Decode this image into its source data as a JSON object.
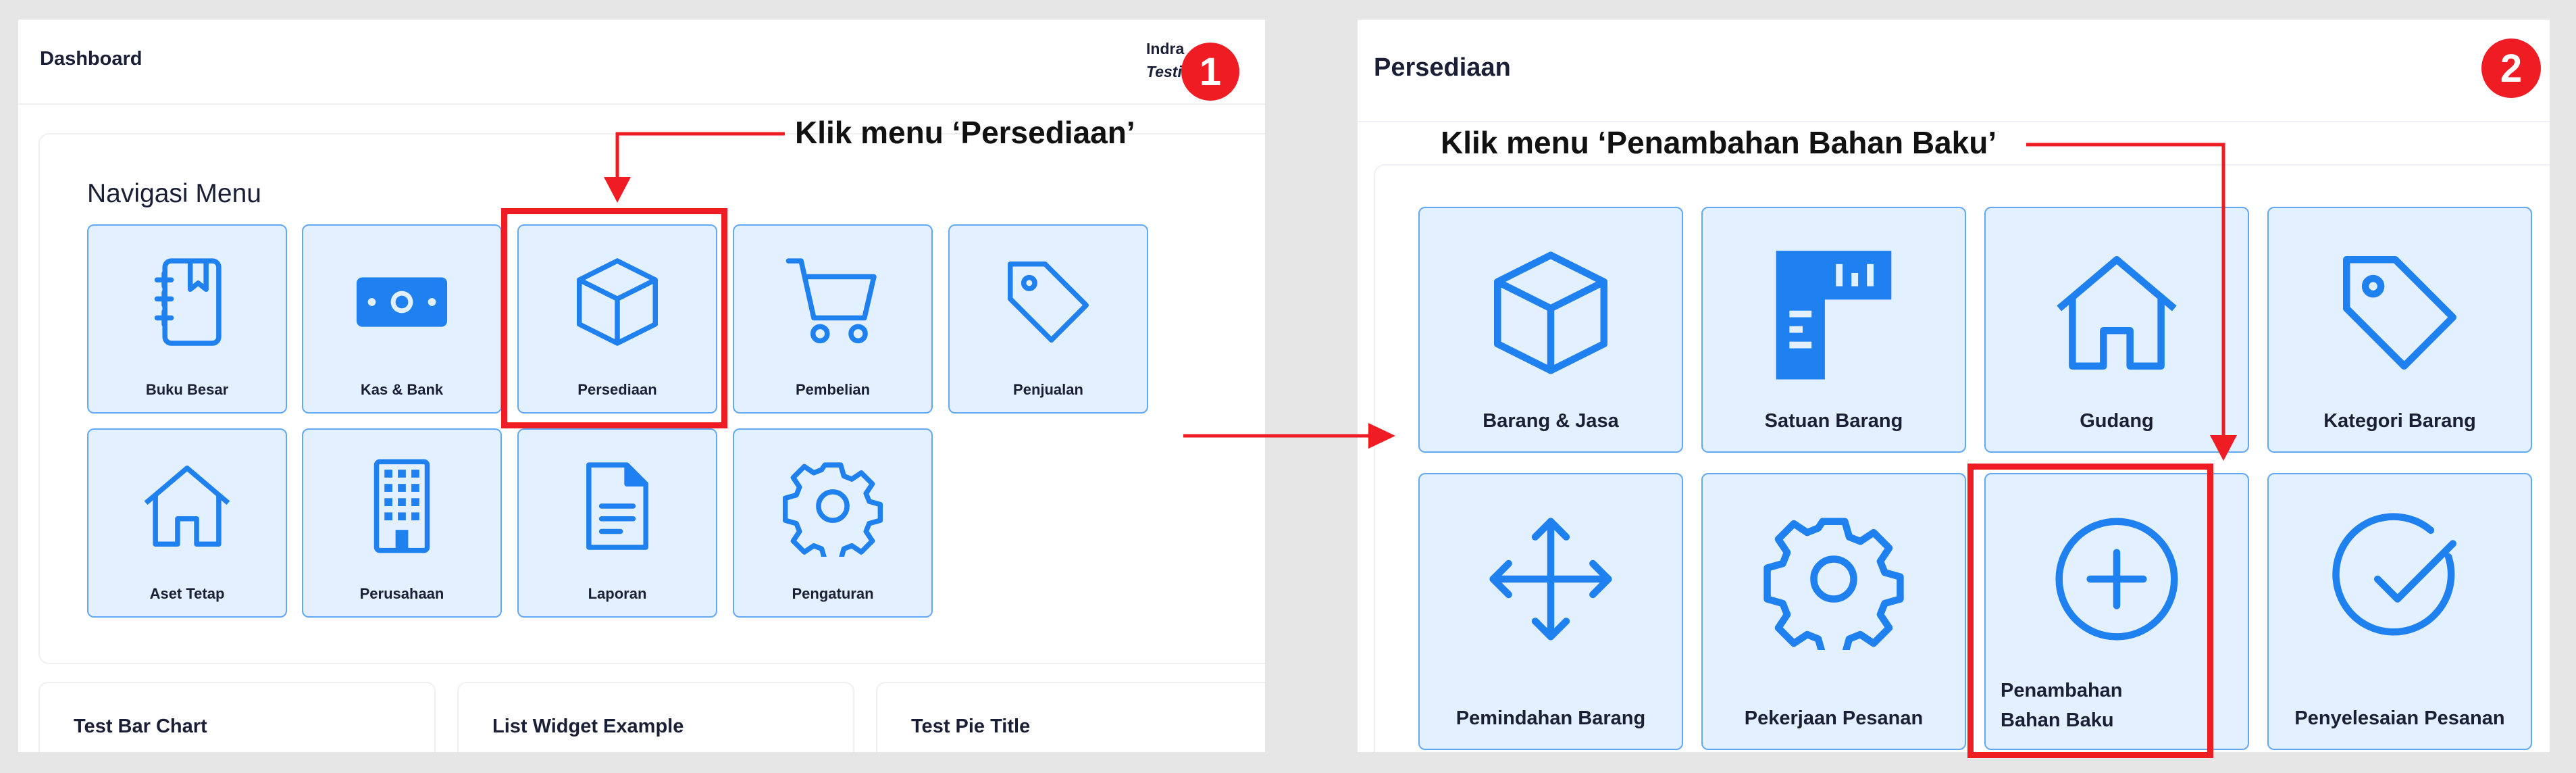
{
  "panel1": {
    "title": "Dashboard",
    "user_name": "Indra",
    "user_role": "Testi",
    "badge": "1",
    "section_title": "Navigasi Menu",
    "menu": [
      {
        "label": "Buku Besar",
        "icon": "ledger-book-icon"
      },
      {
        "label": "Kas & Bank",
        "icon": "banknote-icon"
      },
      {
        "label": "Persediaan",
        "icon": "box-icon"
      },
      {
        "label": "Pembelian",
        "icon": "shopping-cart-icon"
      },
      {
        "label": "Penjualan",
        "icon": "price-tag-icon"
      },
      {
        "label": "Aset Tetap",
        "icon": "house-icon"
      },
      {
        "label": "Perusahaan",
        "icon": "building-icon"
      },
      {
        "label": "Laporan",
        "icon": "document-icon"
      },
      {
        "label": "Pengaturan",
        "icon": "gear-icon"
      }
    ],
    "widgets": [
      "Test Bar Chart",
      "List Widget Example",
      "Test Pie Title"
    ],
    "annotation": "Klik menu ‘Persediaan’"
  },
  "panel2": {
    "title": "Persediaan",
    "badge": "2",
    "menu": [
      {
        "label": "Barang & Jasa",
        "icon": "box-icon"
      },
      {
        "label": "Satuan Barang",
        "icon": "ruler-icon"
      },
      {
        "label": "Gudang",
        "icon": "house-icon"
      },
      {
        "label": "Kategori Barang",
        "icon": "price-tag-icon"
      },
      {
        "label": "Pemindahan Barang",
        "icon": "move-arrows-icon"
      },
      {
        "label": "Pekerjaan Pesanan",
        "icon": "gear-icon"
      },
      {
        "label": "Penambahan Bahan Baku",
        "icon": "plus-circle-icon"
      },
      {
        "label": "Penyelesaian Pesanan",
        "icon": "check-circle-icon"
      }
    ],
    "annotation": "Klik menu ‘Penambahan Bahan Baku’"
  },
  "colors": {
    "accent": "#1f80f0",
    "tile_bg": "#e3f0ff",
    "tile_border": "#63a8f2",
    "highlight": "#ef1c24"
  }
}
